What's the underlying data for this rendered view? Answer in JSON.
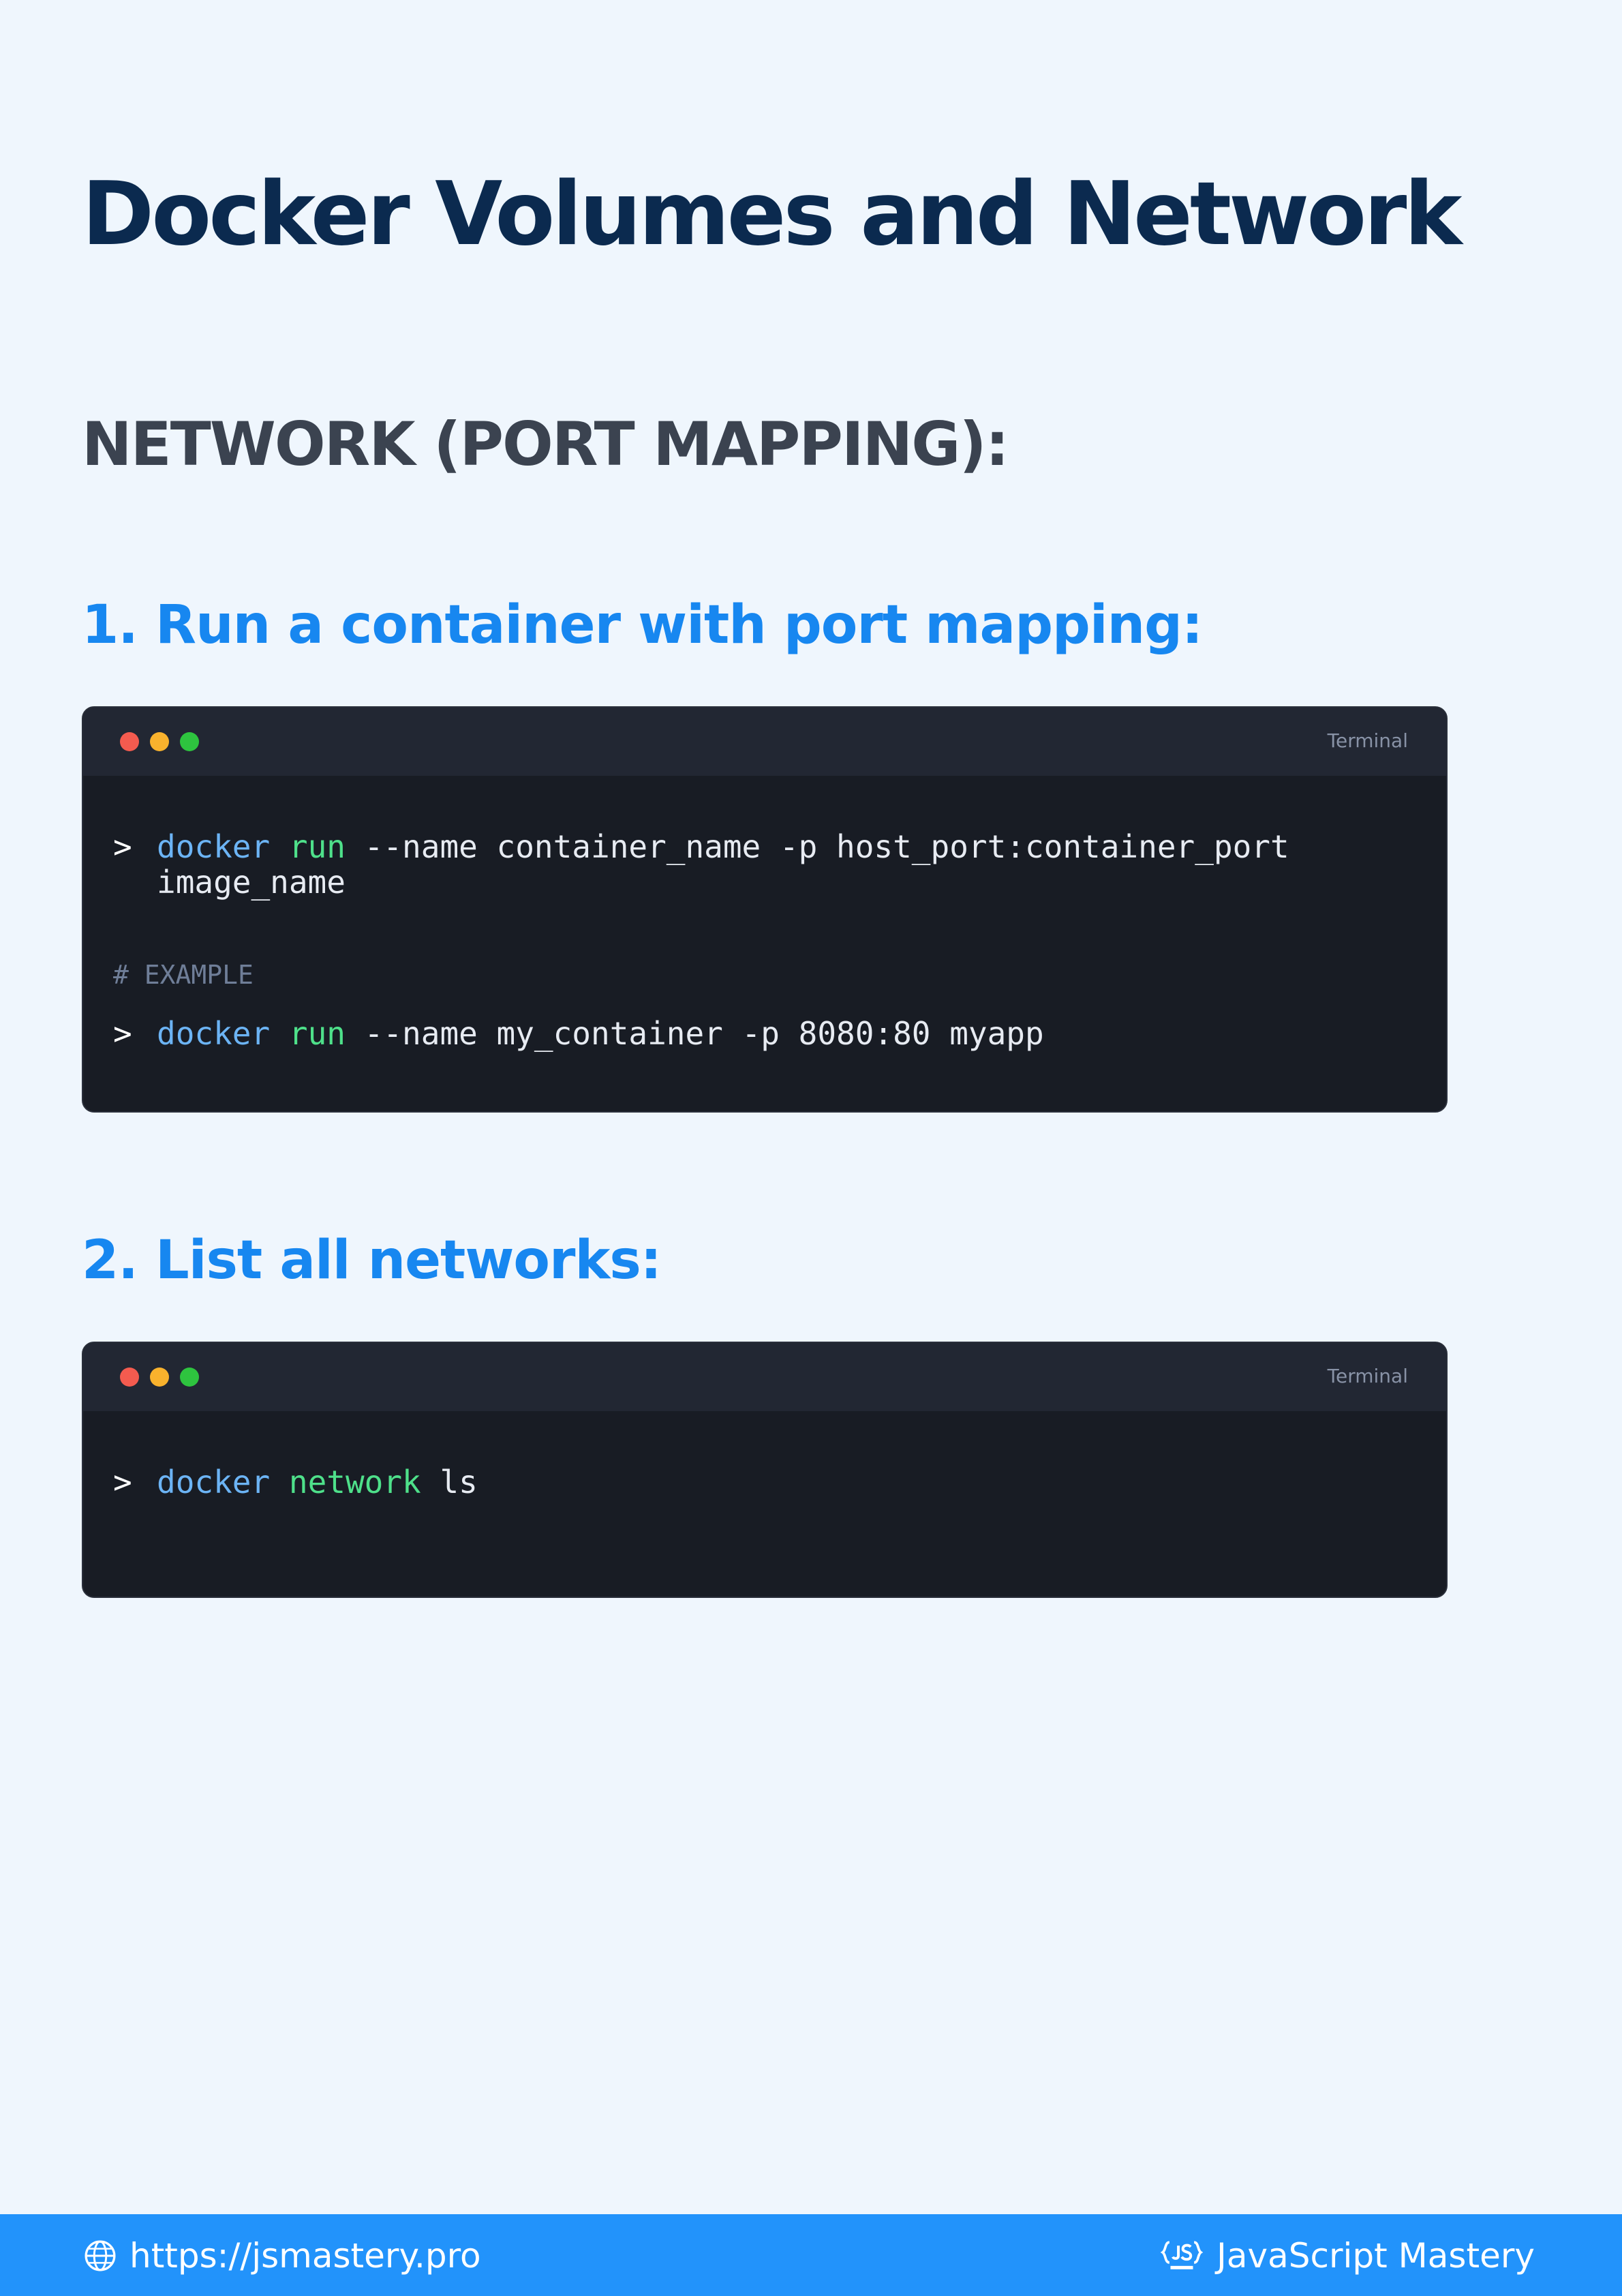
{
  "title": "Docker Volumes and Network",
  "section": "NETWORK (PORT MAPPING):",
  "steps": [
    {
      "heading": "1. Run a container with port mapping:",
      "terminal_label": "Terminal",
      "command": {
        "prompt": ">",
        "tool": "docker",
        "sub": "run",
        "rest": " --name container_name -p host_port:container_port image_name"
      },
      "comment": "# EXAMPLE",
      "example": {
        "prompt": ">",
        "tool": "docker",
        "sub": "run",
        "rest": " --name my_container -p 8080:80 myapp"
      }
    },
    {
      "heading": "2. List all networks:",
      "terminal_label": "Terminal",
      "command": {
        "prompt": ">",
        "tool": "docker",
        "sub": "network",
        "rest": " ls"
      }
    }
  ],
  "footer": {
    "url": "https://jsmastery.pro",
    "brand": "JavaScript Mastery",
    "icons": {
      "url": "globe-icon",
      "brand": "js-mastery-logo"
    }
  },
  "colors": {
    "background": "#eff6fd",
    "title": "#0b2a4f",
    "accent": "#1787f0",
    "footer": "#2293fb",
    "terminal": "#181c24",
    "keyword_docker": "#6cb4f5",
    "keyword_sub": "#4ee08a"
  }
}
